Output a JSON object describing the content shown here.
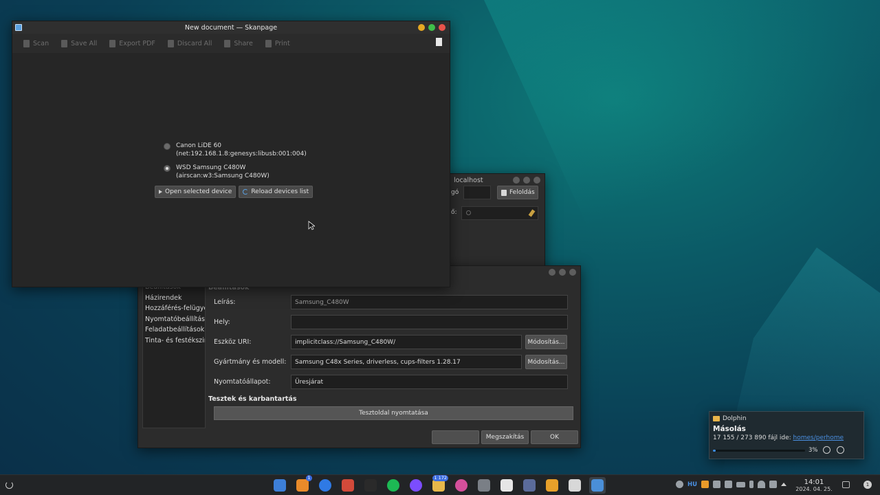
{
  "skanpage": {
    "title": "New document — Skanpage",
    "toolbar": [
      "Scan",
      "Save All",
      "Export PDF",
      "Discard All",
      "Share",
      "Print"
    ],
    "devices": [
      {
        "name": "Canon LiDE 60",
        "id": "(net:192.168.1.8:genesys:libusb:001:004)",
        "selected": false
      },
      {
        "name": "WSD Samsung C480W",
        "id": "(airscan:w3:Samsung C480W)",
        "selected": true
      }
    ],
    "open_btn": "Open selected device",
    "reload_btn": "Reload devices list"
  },
  "cups_main": {
    "title": "localhost",
    "label_top": "gó",
    "label_mid": "ő:",
    "unlock_btn": "Feloldás"
  },
  "printer_dialog": {
    "sidebar": [
      "Beállítások",
      "Házirendek",
      "Hozzáférés-felügyelet",
      "Nyomtatóbeállítások",
      "Feladatbeállítások",
      "Tinta- és festékszint"
    ],
    "section_settings": "Beállítások",
    "fields": {
      "description_label": "Leírás:",
      "description_value": "Samsung_C480W",
      "location_label": "Hely:",
      "location_value": "",
      "uri_label": "Eszköz URI:",
      "uri_value": "implicitclass://Samsung_C480W/",
      "make_label": "Gyártmány és modell:",
      "make_value": "Samsung C48x Series, driverless, cups-filters 1.28.17",
      "state_label": "Nyomtatóállapot:",
      "state_value": "Üresjárat"
    },
    "modify_btn": "Módosítás...",
    "section_tests": "Tesztek és karbantartás",
    "test_btn": "Tesztoldal nyomtatása",
    "cancel_btn": "Megszakítás",
    "ok_btn": "OK",
    "apply_btn": ""
  },
  "notification": {
    "app": "Dolphin",
    "title": "Másolás",
    "progress_text": "17 155 / 273 890 fájl ide: ",
    "link": "homes/perhome",
    "percent": "3%",
    "progress_value": 0.03
  },
  "taskbar": {
    "badges": {
      "files": "1",
      "mail": "1 172"
    },
    "keyboard": "HU",
    "time": "14:01",
    "date": "2024. 04. 25.",
    "notif_count": "1",
    "task_icons": [
      "dolphin-file-manager-icon",
      "home-folder-icon",
      "chromium-icon",
      "double-commander-icon",
      "terminal-icon",
      "spotify-icon",
      "messenger-icon",
      "mail-icon",
      "color-picker-icon",
      "system-settings-icon",
      "hyper-icon",
      "gimp-icon",
      "update-icon",
      "printer-icon",
      "skanpage-icon"
    ],
    "task_colors": [
      "#3d7fd8",
      "#e88a2a",
      "#2f7ae5",
      "#d24a3a",
      "#2a2a2a",
      "#1db954",
      "#7b4dff",
      "#e8b84a",
      "#d44f9a",
      "#7a7f86",
      "#e6e6e6",
      "#5b6b9a",
      "#e8a02a",
      "#d8d8d8",
      "#4a8fd8"
    ]
  }
}
